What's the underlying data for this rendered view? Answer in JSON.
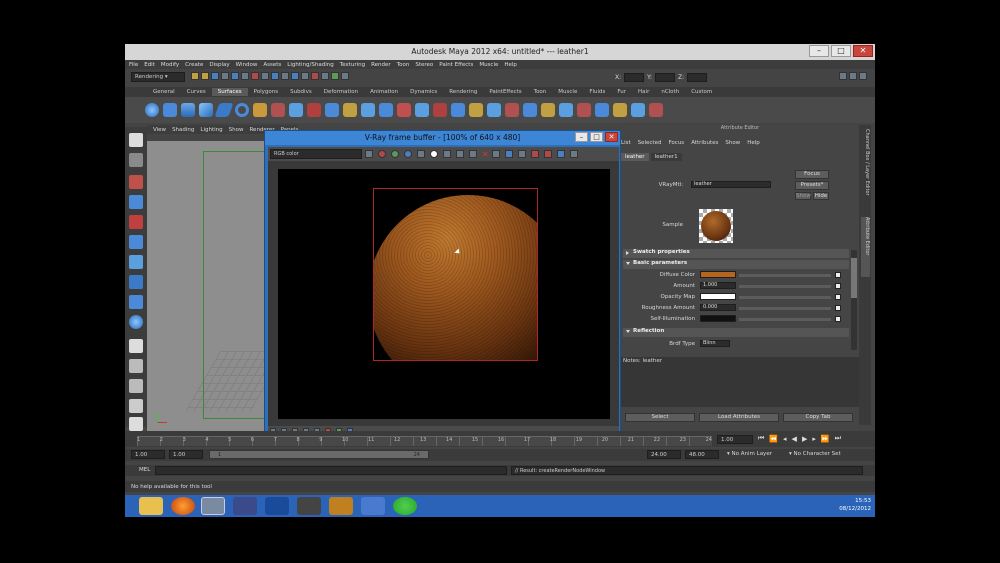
{
  "window": {
    "title": "Autodesk Maya 2012 x64: untitled*  ---  leather1",
    "min": "–",
    "max": "□",
    "close": "✕"
  },
  "menubar": [
    "File",
    "Edit",
    "Modify",
    "Create",
    "Display",
    "Window",
    "Assets",
    "Lighting/Shading",
    "Texturing",
    "Render",
    "Toon",
    "Stereo",
    "Paint Effects",
    "Muscle",
    "Help"
  ],
  "status": {
    "menuset": "Rendering",
    "x_label": "X:",
    "y_label": "Y:",
    "z_label": "Z:"
  },
  "shelf_tabs": [
    "General",
    "Curves",
    "Surfaces",
    "Polygons",
    "Subdivs",
    "Deformation",
    "Animation",
    "Dynamics",
    "Rendering",
    "PaintEffects",
    "Toon",
    "Muscle",
    "Fluids",
    "Fur",
    "Hair",
    "nCloth",
    "Custom"
  ],
  "shelf_active": "Surfaces",
  "viewport_menu": [
    "View",
    "Shading",
    "Lighting",
    "Show",
    "Renderer",
    "Panels"
  ],
  "vray": {
    "title": "V-Ray frame buffer - [100% of 640 x 480]",
    "channel": "RGB color"
  },
  "attr_editor": {
    "header": "Attribute Editor",
    "menu": [
      "List",
      "Selected",
      "Focus",
      "Attributes",
      "Show",
      "Help"
    ],
    "tabs": [
      "leather",
      "leather1"
    ],
    "active_tab": "leather",
    "type_label": "VRayMtl:",
    "name_value": "leather",
    "focus_btn": "Focus",
    "presets_btn": "Presets*",
    "show_btn": "Show",
    "hide_btn": "Hide",
    "sample_label": "Sample",
    "sections": {
      "swatch": "Swatch properties",
      "basic": "Basic parameters",
      "reflection": "Reflection"
    },
    "rows": {
      "diffuse_color": "Diffuse Color",
      "amount": "Amount",
      "amount_value": "1.000",
      "opacity_map": "Opacity Map",
      "roughness": "Roughness Amount",
      "roughness_value": "0.000",
      "self_illum": "Self-Illumination",
      "brdf": "Brdf Type",
      "brdf_value": "Blinn"
    },
    "notes": "Notes: leather",
    "select_btn": "Select",
    "load_btn": "Load Attributes",
    "copy_btn": "Copy Tab",
    "colors": {
      "diffuse": "#b5651d",
      "opacity": "#ffffff",
      "selfillum": "#111111"
    }
  },
  "side_tabs": [
    "Channel Box / Layer Editor",
    "Attribute Editor"
  ],
  "timeline": {
    "ticks": [
      "1",
      "2",
      "3",
      "4",
      "5",
      "6",
      "7",
      "8",
      "9",
      "10",
      "11",
      "12",
      "13",
      "14",
      "15",
      "16",
      "17",
      "18",
      "19",
      "20",
      "21",
      "22",
      "23",
      "24"
    ],
    "current": "1.00"
  },
  "range": {
    "start": "1.00",
    "start2": "1.00",
    "slider_min": "1",
    "slider_max": "24",
    "end": "24.00",
    "end2": "48.00",
    "anim_layer": "No Anim Layer",
    "char_set": "No Character Set"
  },
  "cmd": {
    "label": "MEL",
    "result": "// Result: createRenderNodeWindow"
  },
  "help_line": "No help available for this tool",
  "tray": {
    "time": "15:53",
    "date": "08/12/2012"
  }
}
